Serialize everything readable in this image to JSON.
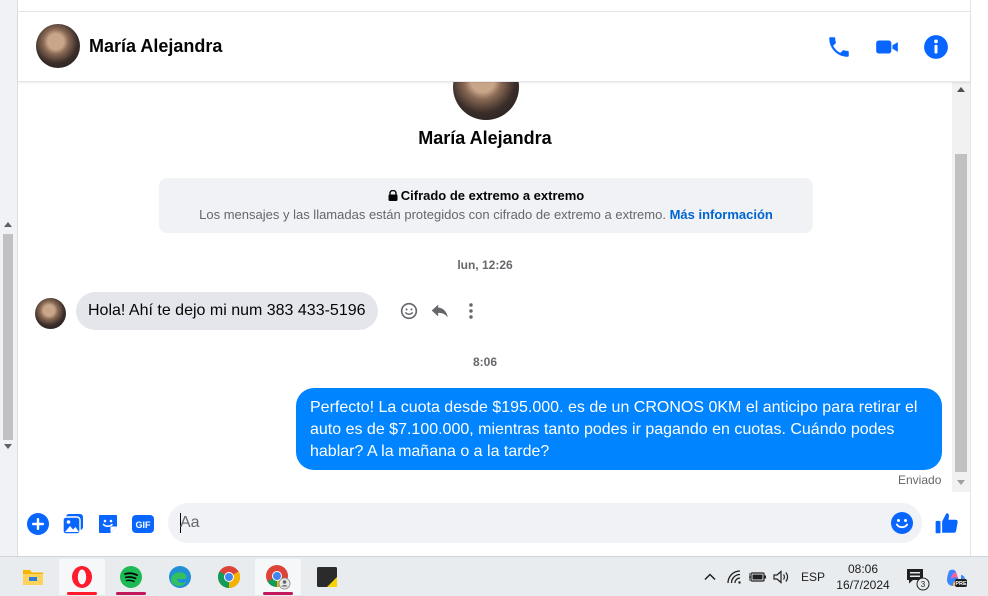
{
  "header": {
    "contact_name": "María Alejandra"
  },
  "conversation": {
    "profile_name": "María Alejandra",
    "encryption": {
      "title": "Cifrado de extremo a extremo",
      "description": "Los mensajes y las llamadas están protegidos con cifrado de extremo a extremo.",
      "link": "Más información"
    },
    "messages": [
      {
        "timestamp": "lun, 12:26",
        "direction": "incoming",
        "text": "Hola! Ahí te dejo mi num 383 433-5196"
      },
      {
        "timestamp": "8:06",
        "direction": "outgoing",
        "text": "Perfecto! La cuota desde $195.000. es de un CRONOS 0KM el anticipo para retirar el auto es de $7.100.000, mientras tanto podes ir pagando en cuotas. Cuándo podes hablar? A la mañana o a la tarde?",
        "status": "Enviado"
      }
    ]
  },
  "composer": {
    "placeholder": "Aa",
    "gif_label": "GIF"
  },
  "taskbar": {
    "apps": [
      "file-explorer",
      "opera",
      "spotify",
      "edge",
      "chrome",
      "chrome-profile",
      "sticky-notes"
    ],
    "language": "ESP",
    "time": "08:06",
    "date": "16/7/2024",
    "notification_count": "3"
  },
  "colors": {
    "accent": "#0084ff",
    "icon_blue": "#0866ff",
    "incoming_bubble": "#e4e6eb",
    "background": "#ffffff",
    "opera": "#ff1b2d",
    "spotify": "#1db954"
  }
}
